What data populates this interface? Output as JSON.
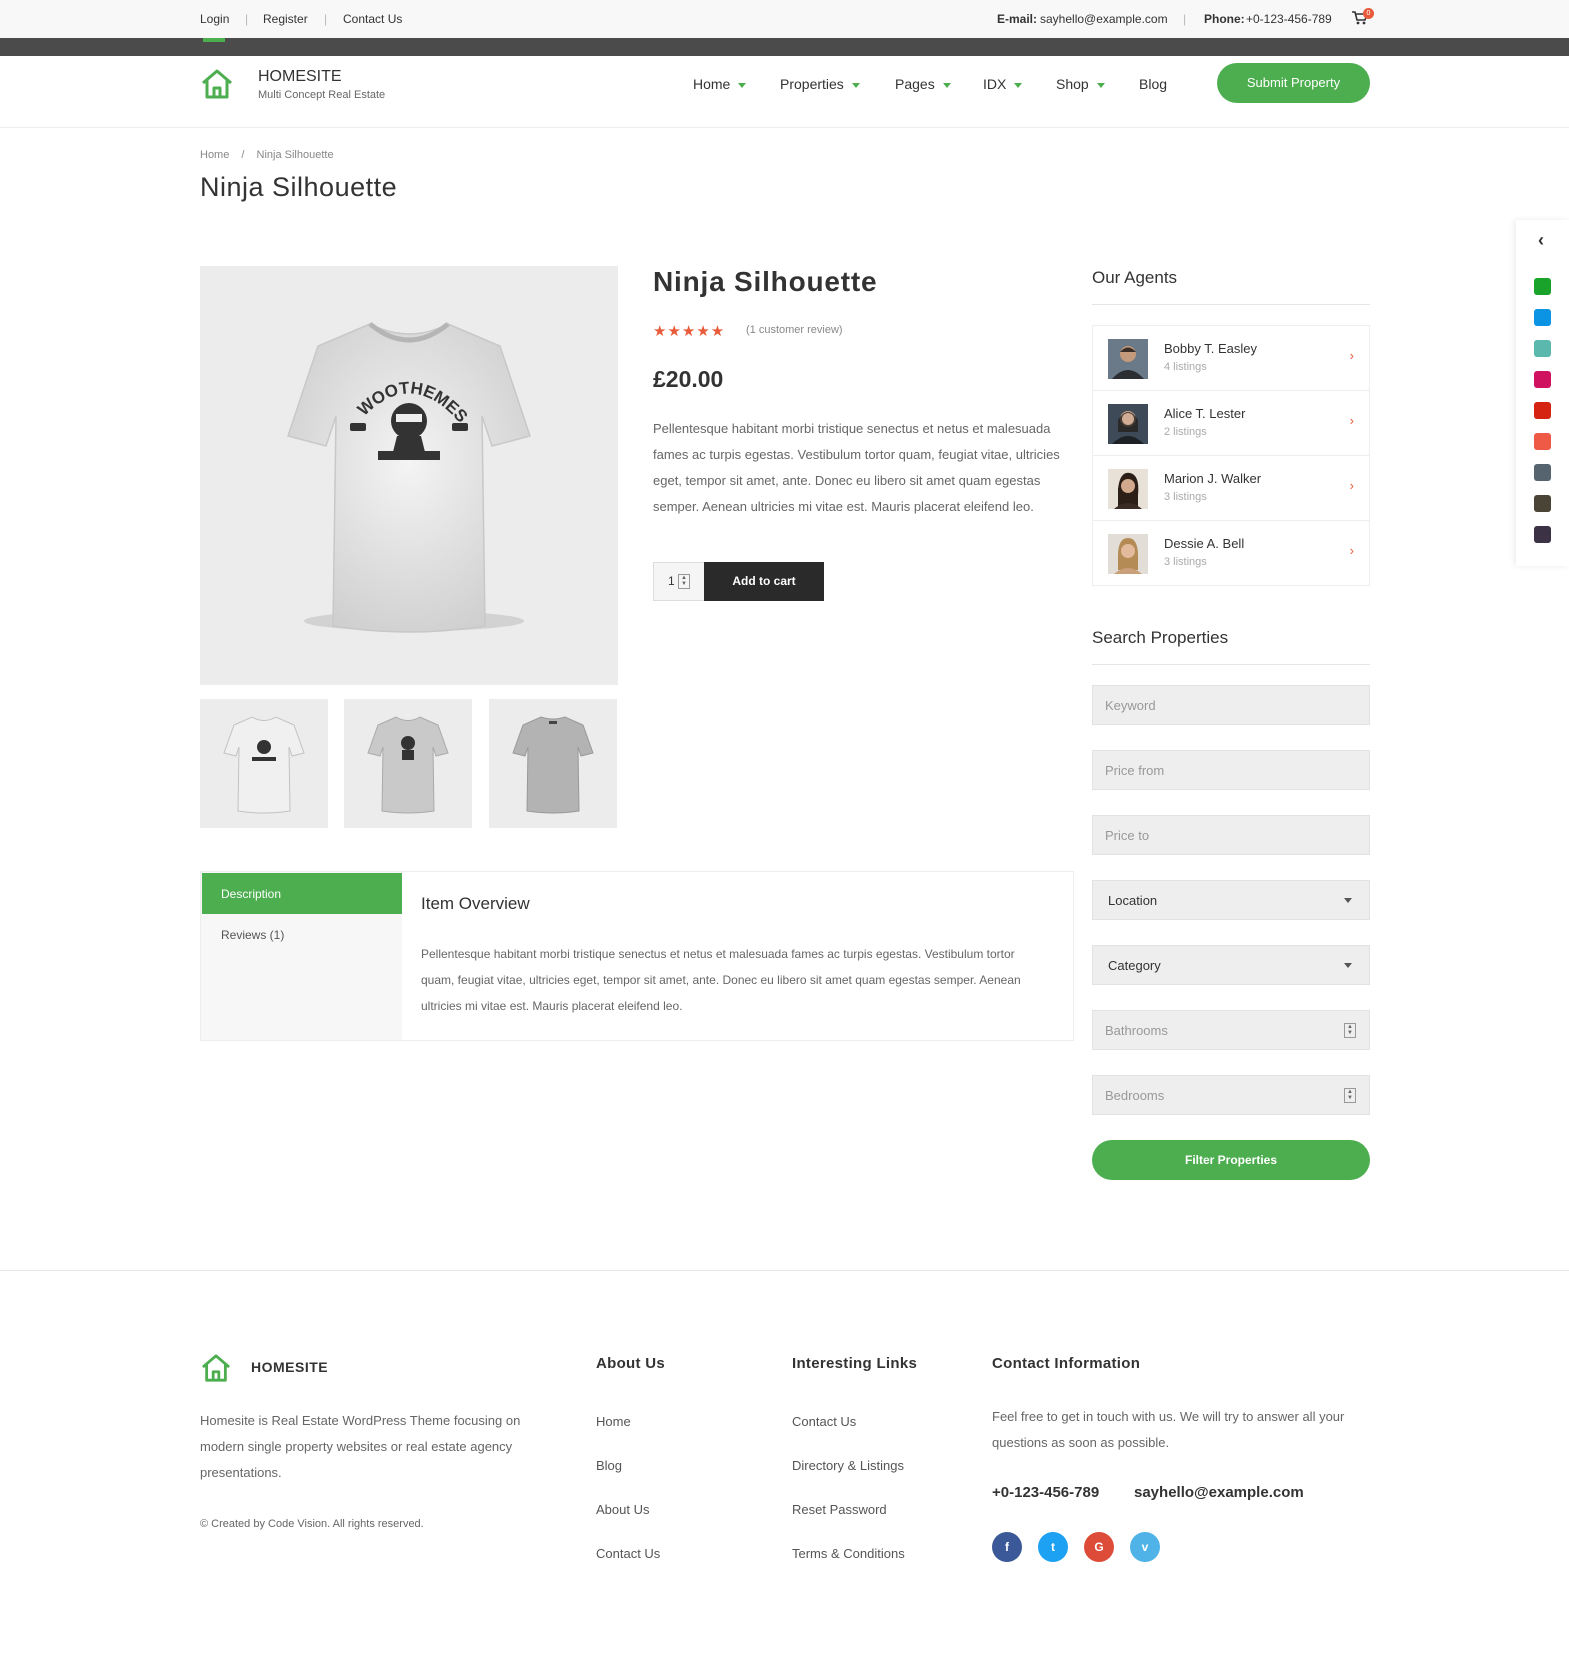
{
  "topbar": {
    "login": "Login",
    "register": "Register",
    "contact": "Contact Us",
    "email_label": "E-mail:",
    "email_value": "sayhello@example.com",
    "phone_label": "Phone:",
    "phone_value": "+0-123-456-789",
    "cart_count": "0"
  },
  "brand": {
    "name": "HOMESITE",
    "tagline": "Multi Concept Real Estate",
    "color": "#4cae4f"
  },
  "nav": {
    "items": [
      {
        "label": "Home"
      },
      {
        "label": "Properties"
      },
      {
        "label": "Pages"
      },
      {
        "label": "IDX"
      },
      {
        "label": "Shop"
      },
      {
        "label": "Blog"
      }
    ],
    "submit_label": "Submit Property"
  },
  "breadcrumb": {
    "home": "Home",
    "sep": "/",
    "current": "Ninja Silhouette"
  },
  "page_title": "Ninja Silhouette",
  "product": {
    "title": "Ninja Silhouette",
    "stars": "★★★★★",
    "rating": 5,
    "review_link": "(1 customer review)",
    "price": "£20.00",
    "description": "Pellentesque habitant morbi tristique senectus et netus et malesuada fames ac turpis egestas. Vestibulum tortor quam, feugiat vitae, ultricies eget, tempor sit amet, ante. Donec eu libero sit amet quam egestas semper. Aenean ultricies mi vitae est. Mauris placerat eleifend leo.",
    "quantity": "1",
    "add_to_cart": "Add to cart",
    "tshirt_text": "WOOTHEMES"
  },
  "tabs": {
    "description": "Description",
    "reviews": "Reviews (1)",
    "heading": "Item Overview",
    "body": "Pellentesque habitant morbi tristique senectus et netus et malesuada fames ac turpis egestas. Vestibulum tortor quam, feugiat vitae, ultricies eget, tempor sit amet, ante. Donec eu libero sit amet quam egestas semper. Aenean ultricies mi vitae est. Mauris placerat eleifend leo."
  },
  "agents": {
    "heading": "Our Agents",
    "list": [
      {
        "name": "Bobby T. Easley",
        "listings": "4 listings"
      },
      {
        "name": "Alice T. Lester",
        "listings": "2 listings"
      },
      {
        "name": "Marion J. Walker",
        "listings": "3 listings"
      },
      {
        "name": "Dessie A. Bell",
        "listings": "3 listings"
      }
    ]
  },
  "search": {
    "heading": "Search Properties",
    "keyword_placeholder": "Keyword",
    "price_from_placeholder": "Price from",
    "price_to_placeholder": "Price to",
    "location": "Location",
    "category": "Category",
    "bathrooms_placeholder": "Bathrooms",
    "bedrooms_placeholder": "Bedrooms",
    "filter_label": "Filter Properties"
  },
  "footer": {
    "brand": "HOMESITE",
    "about_text": "Homesite is Real Estate WordPress Theme focusing on modern single property websites or real estate agency presentations.",
    "copyright": "© Created by Code Vision. All rights reserved.",
    "about_heading": "About Us",
    "about_links": [
      "Home",
      "Blog",
      "About Us",
      "Contact Us"
    ],
    "links_heading": "Interesting Links",
    "interesting_links": [
      "Contact Us",
      "Directory & Listings",
      "Reset Password",
      "Terms & Conditions"
    ],
    "contact_heading": "Contact Information",
    "contact_text": "Feel free to get in touch with us. We will try to answer all your questions as soon as possible.",
    "phone": "+0-123-456-789",
    "email": "sayhello@example.com",
    "social": [
      {
        "icon": "facebook-icon",
        "glyph": "f",
        "color": "#3b5998"
      },
      {
        "icon": "twitter-icon",
        "glyph": "t",
        "color": "#1da1f2"
      },
      {
        "icon": "google-plus-icon",
        "glyph": "G",
        "color": "#dd4b39"
      },
      {
        "icon": "vimeo-icon",
        "glyph": "v",
        "color": "#4fb3e8"
      }
    ]
  },
  "color_switcher": {
    "toggle": "‹",
    "colors": [
      "#1aa32b",
      "#0a94e3",
      "#5ab8ad",
      "#d0115f",
      "#d52411",
      "#ee5a45",
      "#56646f",
      "#4a4436",
      "#3b3245"
    ]
  }
}
